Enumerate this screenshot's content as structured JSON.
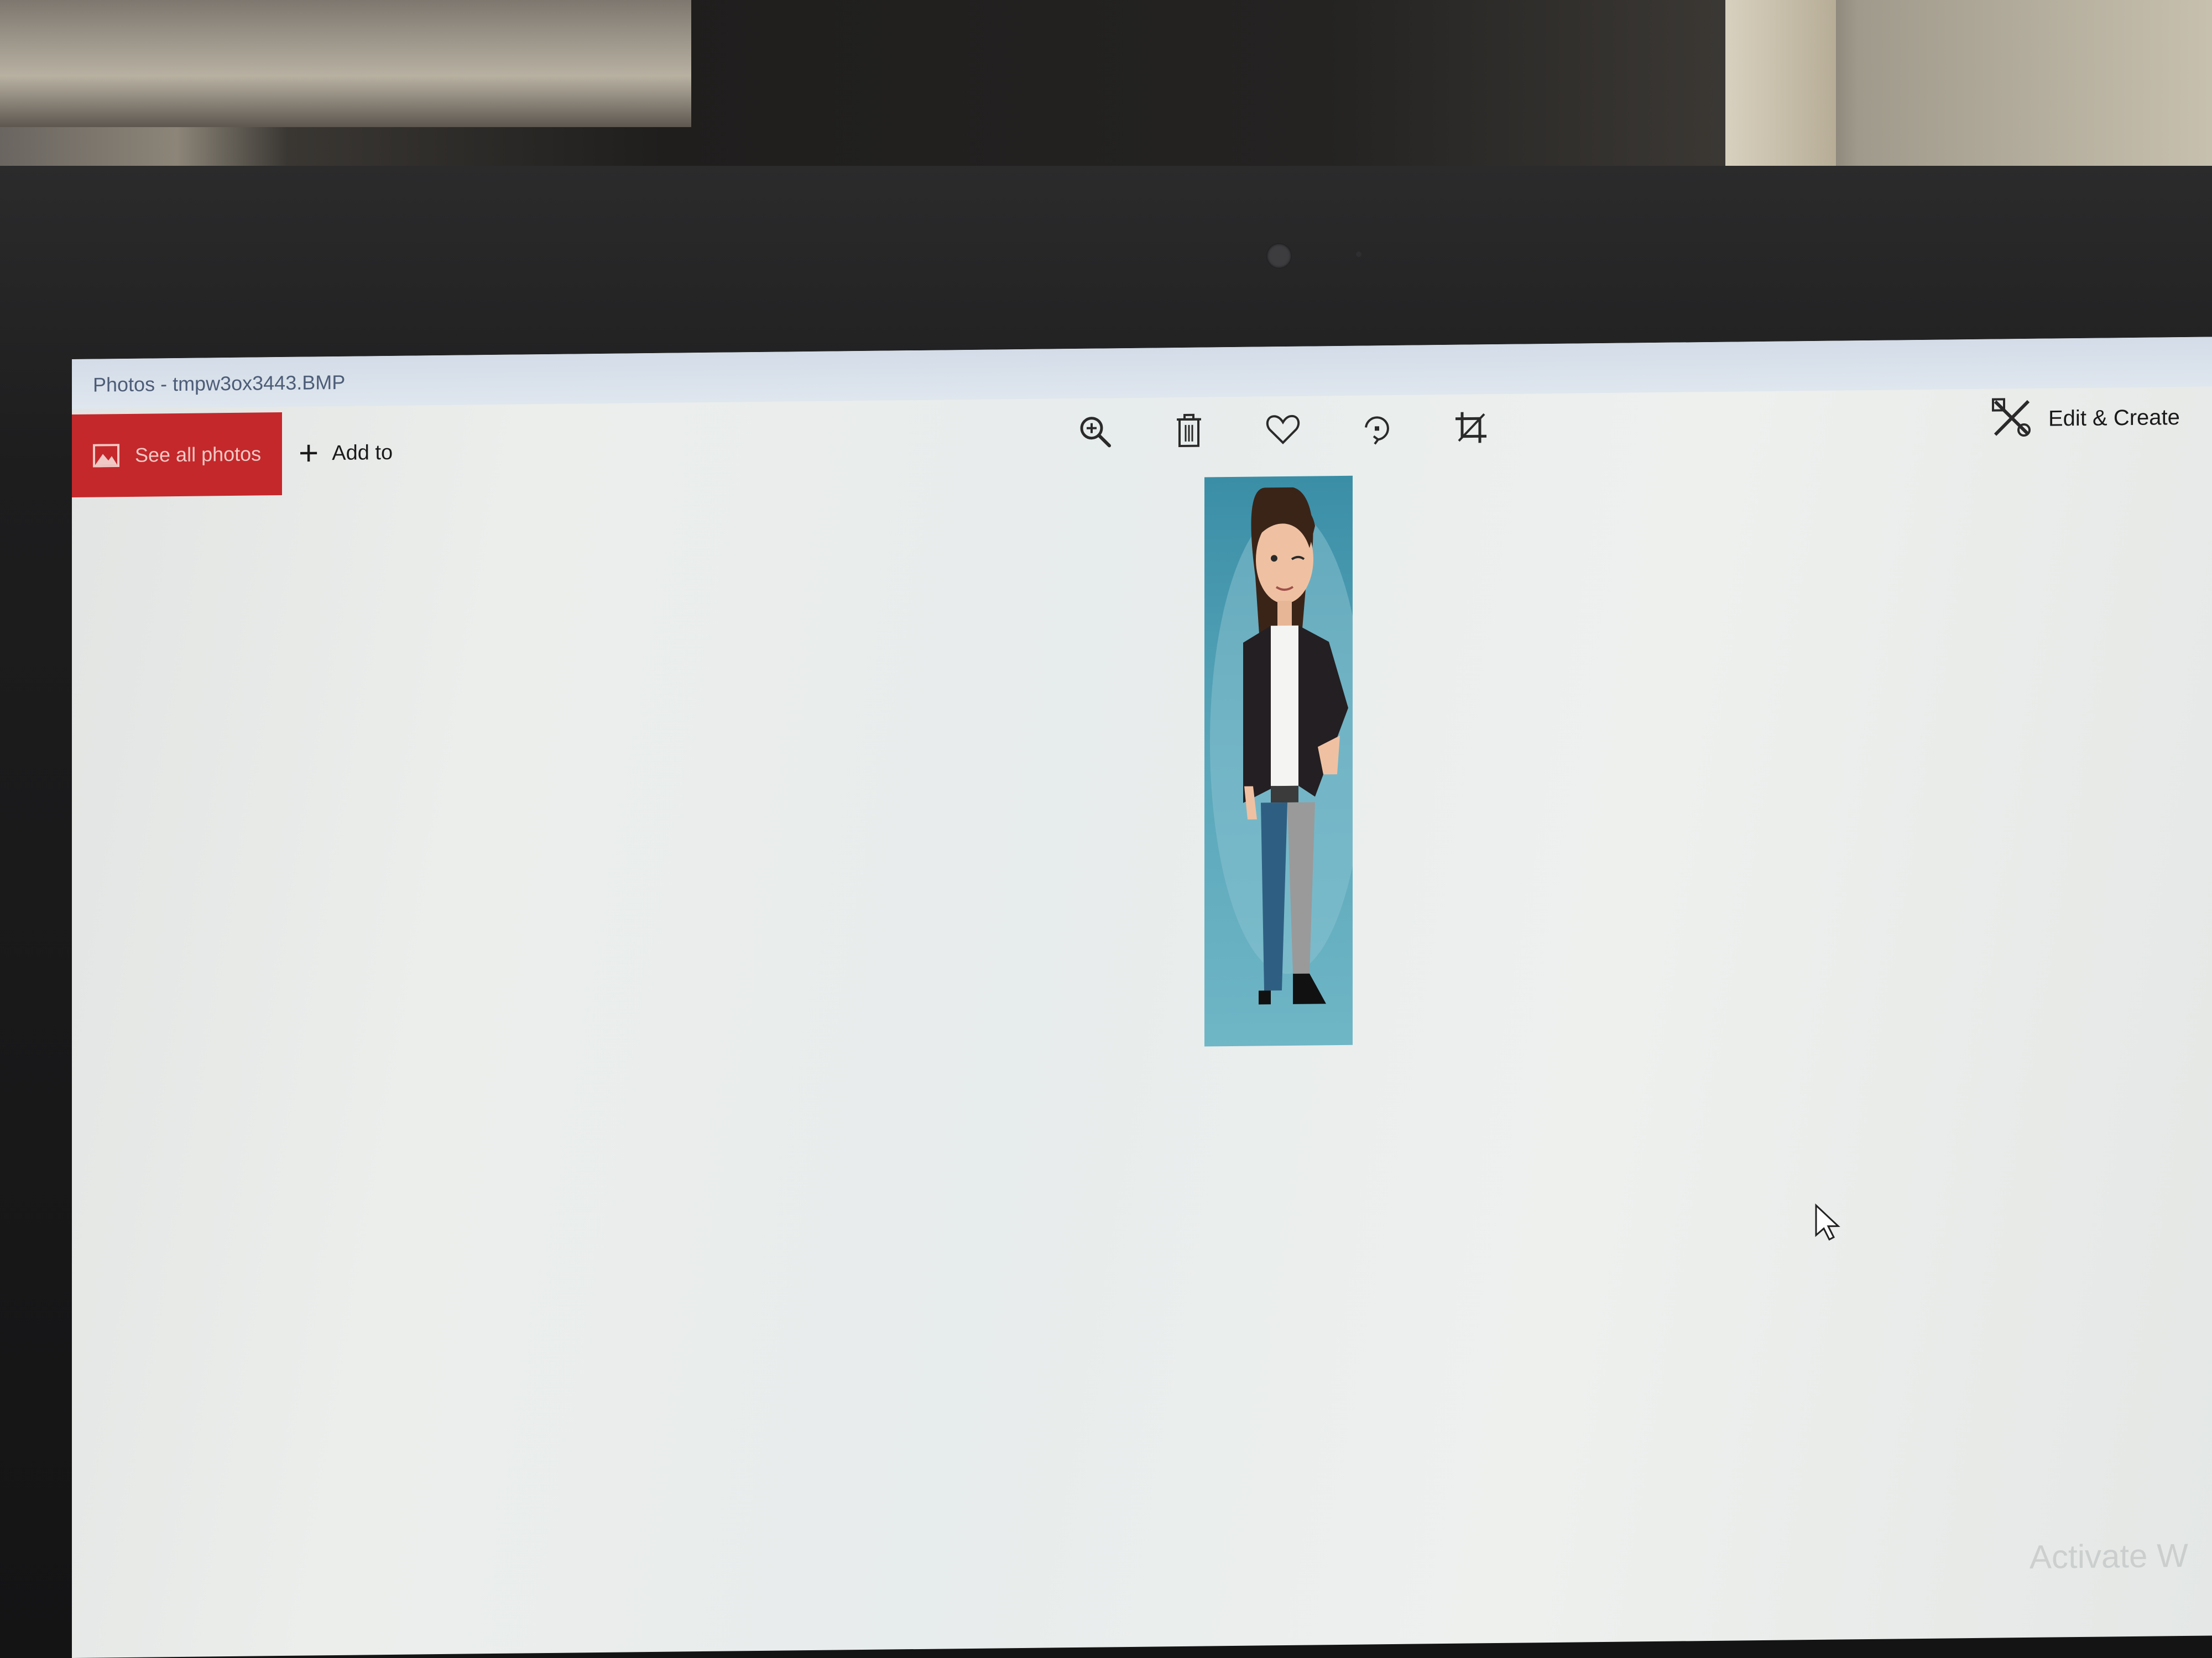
{
  "window": {
    "title": "Photos - tmpw3ox3443.BMP"
  },
  "toolbar": {
    "see_all_photos_label": "See all photos",
    "add_to_label": "Add to",
    "edit_create_label": "Edit & Create",
    "icons": [
      "zoom-in-icon",
      "delete-icon",
      "favorite-heart-icon",
      "rotate-icon",
      "crop-icon"
    ]
  },
  "watermark": {
    "text": "Activate W"
  },
  "colors": {
    "accent": "#c4282b",
    "photo_background": "#4e9fb5"
  }
}
